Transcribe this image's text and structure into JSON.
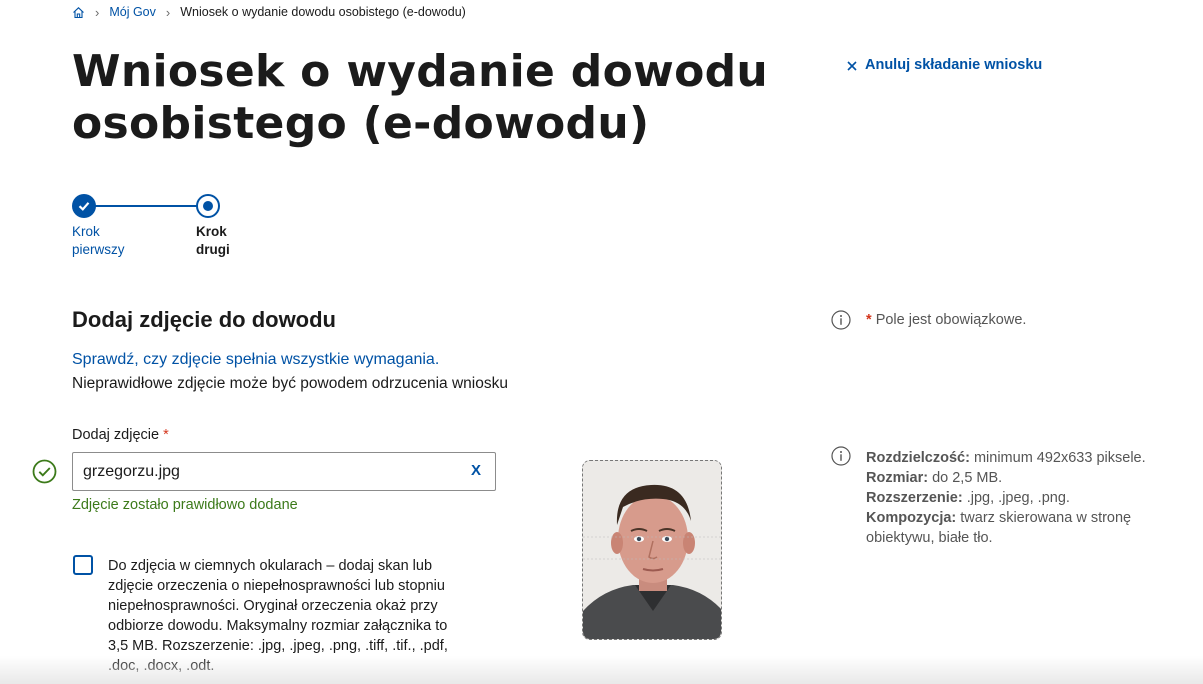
{
  "breadcrumb": {
    "home_icon": "home-icon",
    "items": [
      "Mój Gov",
      "Wniosek o wydanie dowodu osobistego (e-dowodu)"
    ]
  },
  "page": {
    "title": "Wniosek o wydanie dowodu osobistego (e-dowodu)",
    "cancel_label": "Anuluj składanie wniosku"
  },
  "stepper": {
    "steps": [
      {
        "label": "Krok pierwszy",
        "state": "done"
      },
      {
        "label": "Krok drugi",
        "state": "current"
      }
    ]
  },
  "section": {
    "title": "Dodaj zdjęcie do dowodu",
    "check_link": "Sprawdź, czy zdjęcie spełnia wszystkie wymagania.",
    "warning": "Nieprawidłowe zdjęcie może być powodem odrzucenia wniosku"
  },
  "upload": {
    "label": "Dodaj zdjęcie",
    "required_mark": "*",
    "file_name": "grzegorzu.jpg",
    "clear_label": "X",
    "success_message": "Zdjęcie zostało prawidłowo dodane"
  },
  "checkbox": {
    "checked": false,
    "text": "Do zdjęcia w ciemnych okularach – dodaj skan lub zdjęcie orzeczenia o niepełnosprawności lub stopniu niepełnosprawności. Oryginał orzeczenia okaż przy odbiorze dowodu. Maksymalny rozmiar załącznika to 3,5 MB. Rozszerzenie: .jpg, .jpeg, .png, .tiff, .tif., .pdf, .doc, .docx, .odt."
  },
  "sidebar": {
    "mandatory_mark": "*",
    "mandatory_note": "Pole jest obowiązkowe.",
    "requirements": [
      {
        "label": "Rozdzielczość:",
        "value": "minimum 492x633 piksele."
      },
      {
        "label": "Rozmiar:",
        "value": "do 2,5 MB."
      },
      {
        "label": "Rozszerzenie:",
        "value": ".jpg, .jpeg, .png."
      },
      {
        "label": "Kompozycja:",
        "value": "twarz skierowana w stronę obiektywu, białe tło."
      }
    ]
  },
  "colors": {
    "brand_blue": "#0052a5",
    "success_green": "#3c7a1a",
    "required_red": "#d4351c"
  }
}
